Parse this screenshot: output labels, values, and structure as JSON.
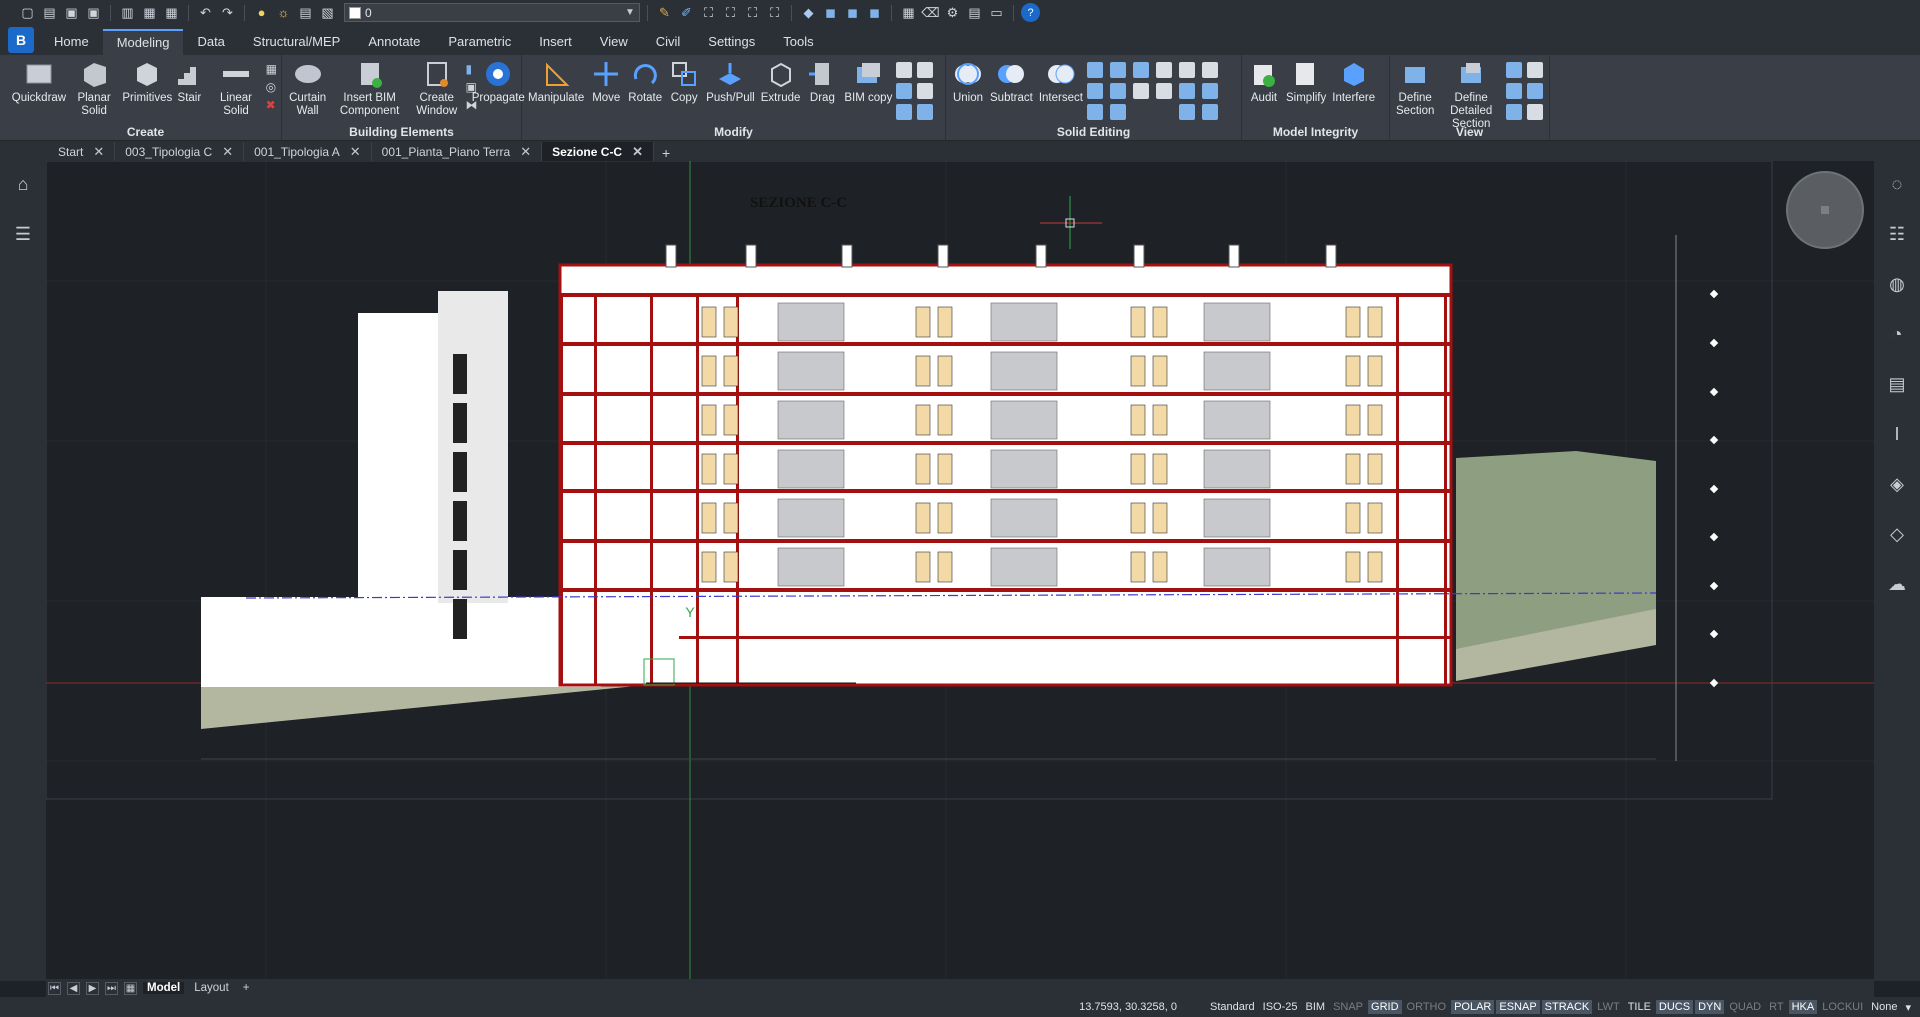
{
  "qat": {
    "layer_value": "0",
    "icons": [
      "new-file-icon",
      "open-icon",
      "save-icon",
      "save-as-icon",
      "plot-icon",
      "print-icon",
      "print-setup-icon",
      "undo-icon",
      "redo-icon",
      "light-icon",
      "sun-icon",
      "print-preview-icon",
      "layer-color-icon",
      "match-properties-icon",
      "brush-icon",
      "select-icon",
      "filter-icon",
      "grip-icon",
      "move-icon",
      "box-icon",
      "cube-icon",
      "cube2-icon",
      "cube3-icon",
      "table-icon",
      "eraser-icon",
      "settings-icon",
      "render-icon",
      "image-icon",
      "help-icon"
    ]
  },
  "ribbon_tabs": [
    "Home",
    "Modeling",
    "Data",
    "Structural/MEP",
    "Annotate",
    "Parametric",
    "Insert",
    "View",
    "Civil",
    "Settings",
    "Tools"
  ],
  "active_ribbon_tab": "Modeling",
  "panels": {
    "create": {
      "title": "Create",
      "tools": [
        "Quickdraw",
        "Planar Solid",
        "Primitives",
        "Stair",
        "Linear Solid"
      ]
    },
    "building": {
      "title": "Building Elements",
      "tools": [
        "Curtain Wall",
        "Insert BIM Component",
        "Create Window",
        "Propagate"
      ]
    },
    "modify": {
      "title": "Modify",
      "tools": [
        "Manipulate",
        "Move",
        "Rotate",
        "Copy",
        "Push/Pull",
        "Extrude",
        "Drag",
        "BIM copy"
      ]
    },
    "solid": {
      "title": "Solid Editing",
      "tools": [
        "Union",
        "Subtract",
        "Intersect"
      ]
    },
    "integrity": {
      "title": "Model Integrity",
      "tools": [
        "Audit",
        "Simplify",
        "Interfere"
      ]
    },
    "view": {
      "title": "View",
      "tools": [
        "Define Section",
        "Define Detailed Section"
      ]
    }
  },
  "doc_tabs": [
    "Start",
    "003_Tipologia C",
    "001_Tipologia A",
    "001_Pianta_Piano Terra",
    "Sezione C-C"
  ],
  "active_doc_tab": "Sezione C-C",
  "drawing": {
    "title": "SEZIONE C-C",
    "ucs_y": "Y",
    "colors": {
      "section_cut": "#a40f10",
      "soil_fill": "#8e9e80",
      "paving": "#b4b7a0",
      "window": "#f2d9a6",
      "background": "#1e2126"
    }
  },
  "layout_tabs": [
    "Model",
    "Layout"
  ],
  "active_layout_tab": "Model",
  "status": {
    "coords": "13.7593, 30.3258, 0",
    "items": [
      {
        "label": "Standard",
        "state": "plain"
      },
      {
        "label": "ISO-25",
        "state": "plain"
      },
      {
        "label": "BIM",
        "state": "plain"
      },
      {
        "label": "SNAP",
        "state": "off"
      },
      {
        "label": "GRID",
        "state": "on"
      },
      {
        "label": "ORTHO",
        "state": "off"
      },
      {
        "label": "POLAR",
        "state": "on"
      },
      {
        "label": "ESNAP",
        "state": "on"
      },
      {
        "label": "STRACK",
        "state": "on"
      },
      {
        "label": "LWT",
        "state": "off"
      },
      {
        "label": "TILE",
        "state": "plain"
      },
      {
        "label": "DUCS",
        "state": "on"
      },
      {
        "label": "DYN",
        "state": "on"
      },
      {
        "label": "QUAD",
        "state": "off"
      },
      {
        "label": "RT",
        "state": "off"
      },
      {
        "label": "HKA",
        "state": "on"
      },
      {
        "label": "LOCKUI",
        "state": "off"
      },
      {
        "label": "None",
        "state": "plain"
      }
    ]
  }
}
